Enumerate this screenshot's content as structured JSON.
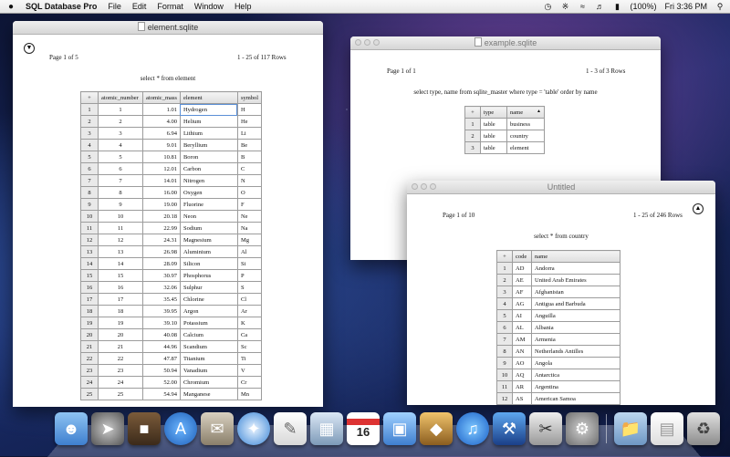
{
  "menubar": {
    "app_name": "SQL Database Pro",
    "items": [
      "File",
      "Edit",
      "Format",
      "Window",
      "Help"
    ],
    "battery": "(100%)",
    "clock": "Fri 3:36 PM"
  },
  "windows": {
    "element": {
      "title": "element.sqlite",
      "page_label": "Page 1 of 5",
      "rows_label": "1 - 25 of 117 Rows",
      "query": "select * from element",
      "columns": [
        "+",
        "atomic_number",
        "atomic_mass",
        "element",
        "symbol"
      ],
      "rows": [
        [
          "1",
          "1",
          "1.01",
          "Hydrogen",
          "H"
        ],
        [
          "2",
          "2",
          "4.00",
          "Helium",
          "He"
        ],
        [
          "3",
          "3",
          "6.94",
          "Lithium",
          "Li"
        ],
        [
          "4",
          "4",
          "9.01",
          "Beryllium",
          "Be"
        ],
        [
          "5",
          "5",
          "10.81",
          "Boron",
          "B"
        ],
        [
          "6",
          "6",
          "12.01",
          "Carbon",
          "C"
        ],
        [
          "7",
          "7",
          "14.01",
          "Nitrogen",
          "N"
        ],
        [
          "8",
          "8",
          "16.00",
          "Oxygen",
          "O"
        ],
        [
          "9",
          "9",
          "19.00",
          "Fluorine",
          "F"
        ],
        [
          "10",
          "10",
          "20.18",
          "Neon",
          "Ne"
        ],
        [
          "11",
          "11",
          "22.99",
          "Sodium",
          "Na"
        ],
        [
          "12",
          "12",
          "24.31",
          "Magnesium",
          "Mg"
        ],
        [
          "13",
          "13",
          "26.98",
          "Aluminium",
          "Al"
        ],
        [
          "14",
          "14",
          "28.09",
          "Silicon",
          "Si"
        ],
        [
          "15",
          "15",
          "30.97",
          "Phosphorus",
          "P"
        ],
        [
          "16",
          "16",
          "32.06",
          "Sulphur",
          "S"
        ],
        [
          "17",
          "17",
          "35.45",
          "Chlorine",
          "Cl"
        ],
        [
          "18",
          "18",
          "39.95",
          "Argon",
          "Ar"
        ],
        [
          "19",
          "19",
          "39.10",
          "Potassium",
          "K"
        ],
        [
          "20",
          "20",
          "40.08",
          "Calcium",
          "Ca"
        ],
        [
          "21",
          "21",
          "44.96",
          "Scandium",
          "Sc"
        ],
        [
          "22",
          "22",
          "47.87",
          "Titanium",
          "Ti"
        ],
        [
          "23",
          "23",
          "50.94",
          "Vanadium",
          "V"
        ],
        [
          "24",
          "24",
          "52.00",
          "Chromium",
          "Cr"
        ],
        [
          "25",
          "25",
          "54.94",
          "Manganese",
          "Mn"
        ]
      ]
    },
    "example": {
      "title": "example.sqlite",
      "page_label": "Page 1 of 1",
      "rows_label": "1 - 3 of 3 Rows",
      "query": "select type, name from sqlite_master where type = 'table' order by name",
      "columns": [
        "+",
        "type",
        "name"
      ],
      "rows": [
        [
          "1",
          "table",
          "business"
        ],
        [
          "2",
          "table",
          "country"
        ],
        [
          "3",
          "table",
          "element"
        ]
      ]
    },
    "untitled": {
      "title": "Untitled",
      "page_label": "Page 1 of 10",
      "rows_label": "1 - 25 of 246 Rows",
      "query": "select * from country",
      "columns": [
        "+",
        "code",
        "name"
      ],
      "rows": [
        [
          "1",
          "AD",
          "Andorra"
        ],
        [
          "2",
          "AE",
          "United Arab Emirates"
        ],
        [
          "3",
          "AF",
          "Afghanistan"
        ],
        [
          "4",
          "AG",
          "Antigua and Barbuda"
        ],
        [
          "5",
          "AI",
          "Anguilla"
        ],
        [
          "6",
          "AL",
          "Albania"
        ],
        [
          "7",
          "AM",
          "Armenia"
        ],
        [
          "8",
          "AN",
          "Netherlands Antilles"
        ],
        [
          "9",
          "AO",
          "Angola"
        ],
        [
          "10",
          "AQ",
          "Antarctica"
        ],
        [
          "11",
          "AR",
          "Argentina"
        ],
        [
          "12",
          "AS",
          "American Samoa"
        ]
      ]
    }
  },
  "dock": {
    "calendar_day": "16",
    "icons": [
      "finder-icon",
      "launchpad-icon",
      "photo-booth-icon",
      "app-store-icon",
      "mail-icon",
      "safari-icon",
      "textedit-icon",
      "sql-database-pro-icon",
      "calendar-icon",
      "preview-icon",
      "iphoto-icon",
      "itunes-icon",
      "xcode-icon",
      "utilities-icon",
      "system-preferences-icon",
      "applications-folder-icon",
      "document-icon",
      "trash-icon"
    ]
  }
}
